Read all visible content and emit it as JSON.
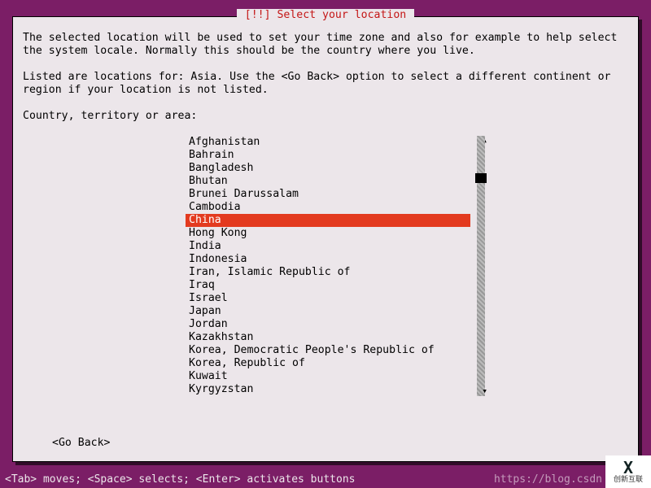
{
  "title": "[!!] Select your location",
  "paragraph1": "The selected location will be used to set your time zone and also for example to help select the system locale. Normally this should be the country where you live.",
  "paragraph2": "Listed are locations for: Asia. Use the <Go Back> option to select a different continent or region if your location is not listed.",
  "prompt": "Country, territory or area:",
  "items": [
    "Afghanistan",
    "Bahrain",
    "Bangladesh",
    "Bhutan",
    "Brunei Darussalam",
    "Cambodia",
    "China",
    "Hong Kong",
    "India",
    "Indonesia",
    "Iran, Islamic Republic of",
    "Iraq",
    "Israel",
    "Japan",
    "Jordan",
    "Kazakhstan",
    "Korea, Democratic People's Republic of",
    "Korea, Republic of",
    "Kuwait",
    "Kyrgyzstan"
  ],
  "selected_index": 6,
  "go_back": "<Go Back>",
  "hint": "<Tab> moves; <Space> selects; <Enter> activates buttons",
  "watermark": "https://blog.csdn",
  "logo_main": "X",
  "logo_sub": "创新互联"
}
